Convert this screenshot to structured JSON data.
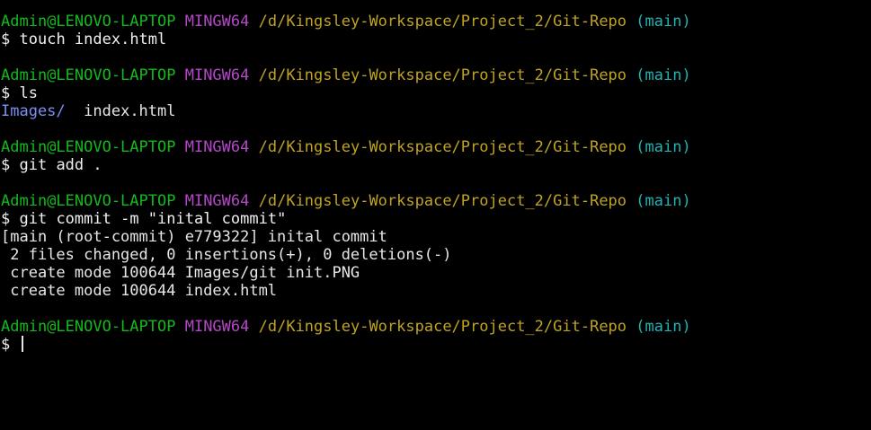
{
  "prompt": {
    "user": "Admin@LENOVO-LAPTOP",
    "env": "MINGW64",
    "path": "/d/Kingsley-Workspace/Project_2/Git-Repo",
    "branch": "(main)",
    "symbol": "$"
  },
  "colors": {
    "background": "#000000",
    "user": "#13ba1d",
    "env": "#b347c8",
    "path": "#bfa320",
    "branch": "#20b3b3",
    "directory": "#7b8ff0",
    "text": "#e6e6e6"
  },
  "blocks": [
    {
      "command": "touch index.html",
      "output": []
    },
    {
      "command": "ls",
      "output": [],
      "ls_output": {
        "dir": "Images/",
        "file": "index.html"
      }
    },
    {
      "command": "git add .",
      "output": []
    },
    {
      "command": "git commit -m \"inital commit\"",
      "output": [
        "[main (root-commit) e779322] inital commit",
        " 2 files changed, 0 insertions(+), 0 deletions(-)",
        " create mode 100644 Images/git init.PNG",
        " create mode 100644 index.html"
      ]
    }
  ]
}
